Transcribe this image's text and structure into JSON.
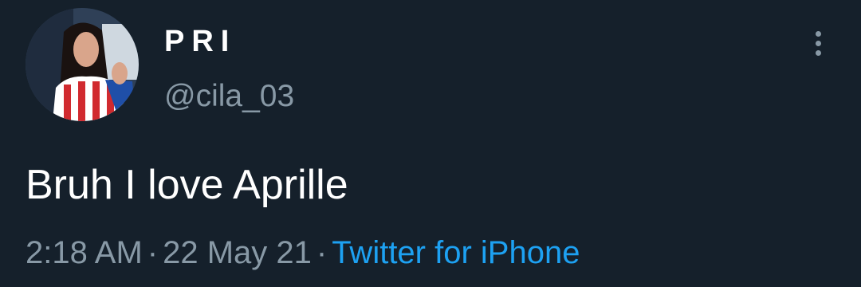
{
  "tweet": {
    "author": {
      "display_name": "PRI",
      "handle": "@cila_03",
      "avatar_icon": "profile-photo"
    },
    "text": "Bruh I love Aprille",
    "time": "2:18 AM",
    "date": "22 May 21",
    "separator": "·",
    "source": "Twitter for iPhone",
    "more_icon": "more-vertical-icon"
  },
  "colors": {
    "background": "#15202b",
    "primary_text": "#ffffff",
    "secondary_text": "#8899a6",
    "link": "#1da1f2"
  }
}
